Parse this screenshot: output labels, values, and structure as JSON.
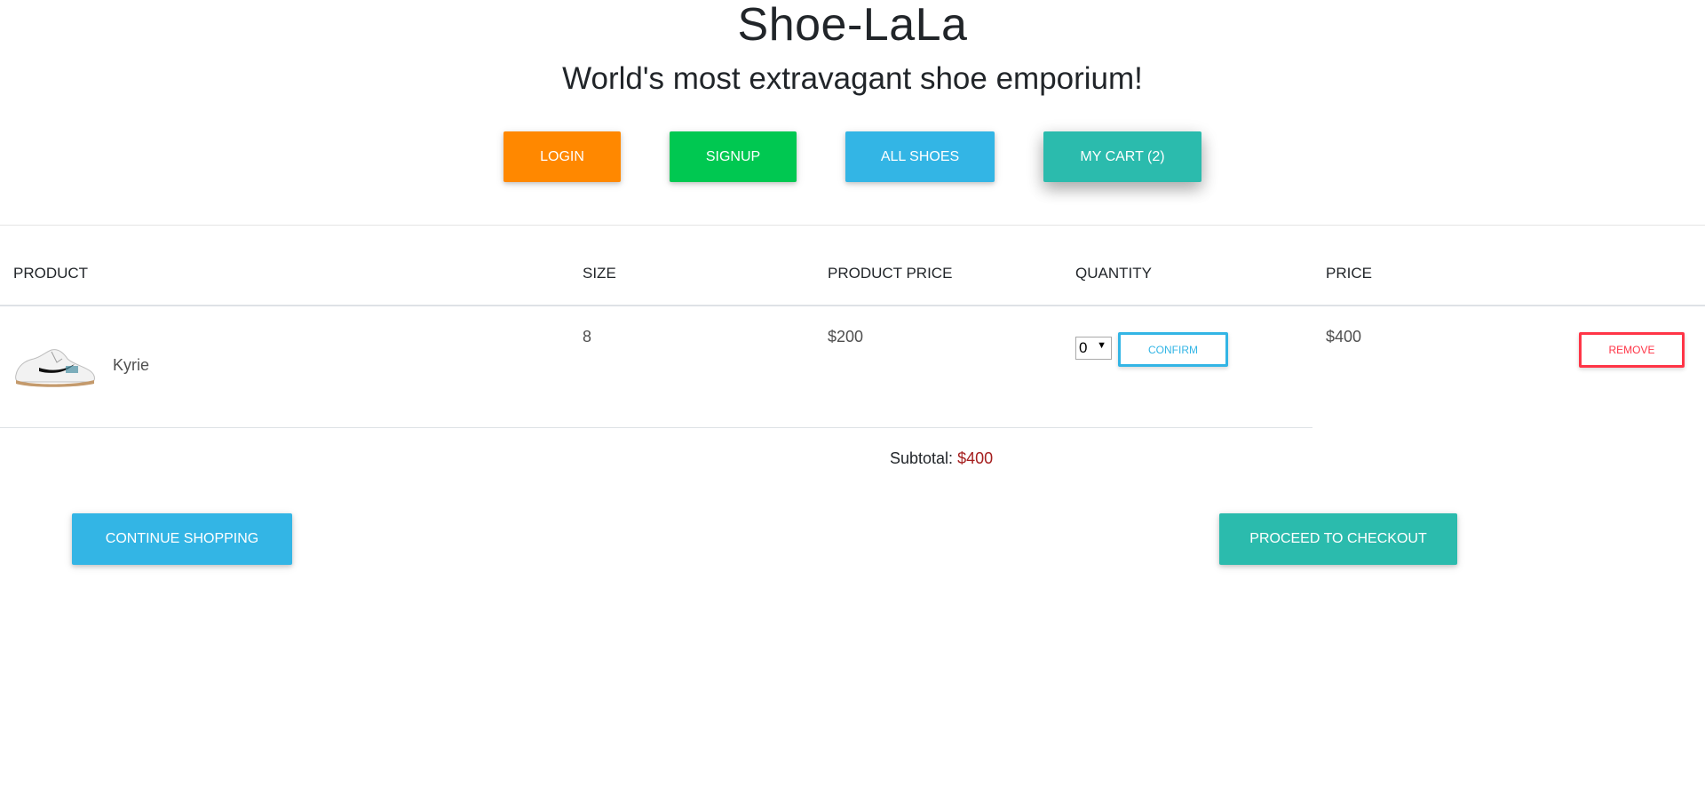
{
  "header": {
    "title": "Shoe-LaLa",
    "subtitle": "World's most extravagant shoe emporium!"
  },
  "nav": {
    "login": "LOGIN",
    "signup": "SIGNUP",
    "all_shoes": "ALL SHOES",
    "my_cart": "MY CART (2)"
  },
  "table": {
    "headers": {
      "product": "PRODUCT",
      "size": "SIZE",
      "product_price": "PRODUCT PRICE",
      "quantity": "QUANTITY",
      "price": "PRICE"
    },
    "rows": [
      {
        "product": "Kyrie",
        "size": "8",
        "product_price": "$200",
        "quantity": "0",
        "confirm_label": "CONFIRM",
        "price": "$400",
        "remove_label": "REMOVE"
      }
    ]
  },
  "subtotal": {
    "label": "Subtotal:",
    "amount": "$400"
  },
  "actions": {
    "continue": "CONTINUE SHOPPING",
    "checkout": "PROCEED TO CHECKOUT"
  },
  "colors": {
    "login": "#ff8800",
    "signup": "#00c851",
    "all_shoes": "#33b5e5",
    "cart": "#2bbbad",
    "remove": "#ff3547",
    "subtotal_amount": "#a51e1e"
  }
}
